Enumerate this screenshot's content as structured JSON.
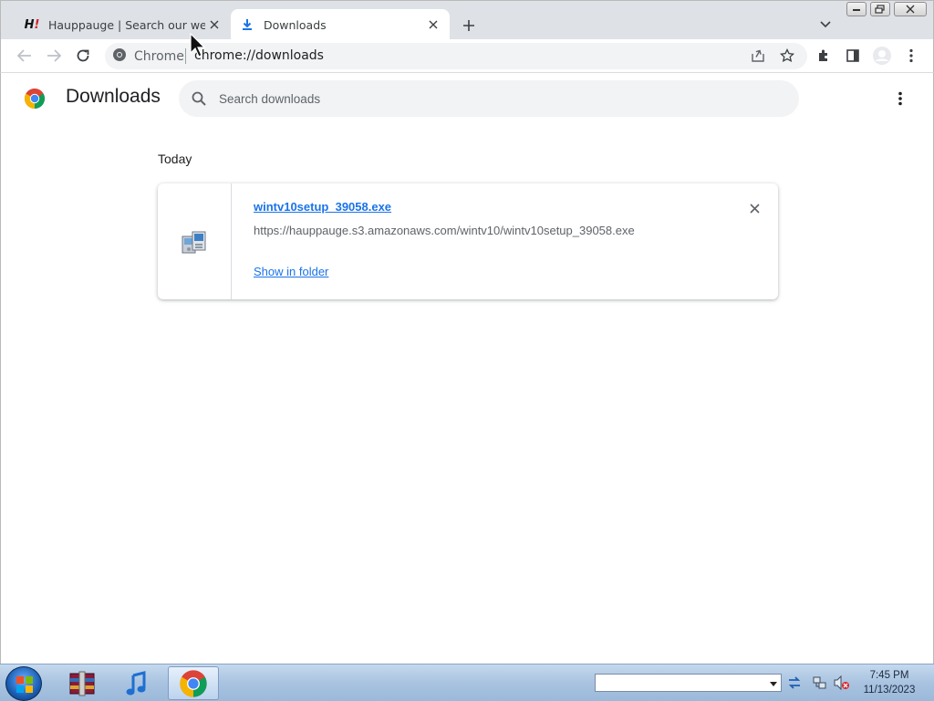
{
  "tabs": [
    {
      "title": "Hauppauge | Search our website",
      "favicon": "hauppauge-logo",
      "active": false
    },
    {
      "title": "Downloads",
      "favicon": "download-icon",
      "active": true
    }
  ],
  "omnibox": {
    "chip_label": "Chrome",
    "url": "chrome://downloads"
  },
  "page": {
    "title": "Downloads",
    "search_placeholder": "Search downloads",
    "section_date": "Today",
    "items": [
      {
        "file_name": "wintv10setup_39058.exe",
        "url": "https://hauppauge.s3.amazonaws.com/wintv10/wintv10setup_39058.exe",
        "action_label": "Show in folder"
      }
    ]
  },
  "taskbar": {
    "time": "7:45 PM",
    "date": "11/13/2023",
    "apps": [
      "winrar-icon",
      "itunes-icon",
      "chrome-icon"
    ]
  },
  "colors": {
    "link": "#1a73e8",
    "tabstrip": "#dee1e6",
    "omnibox": "#f1f3f4"
  }
}
